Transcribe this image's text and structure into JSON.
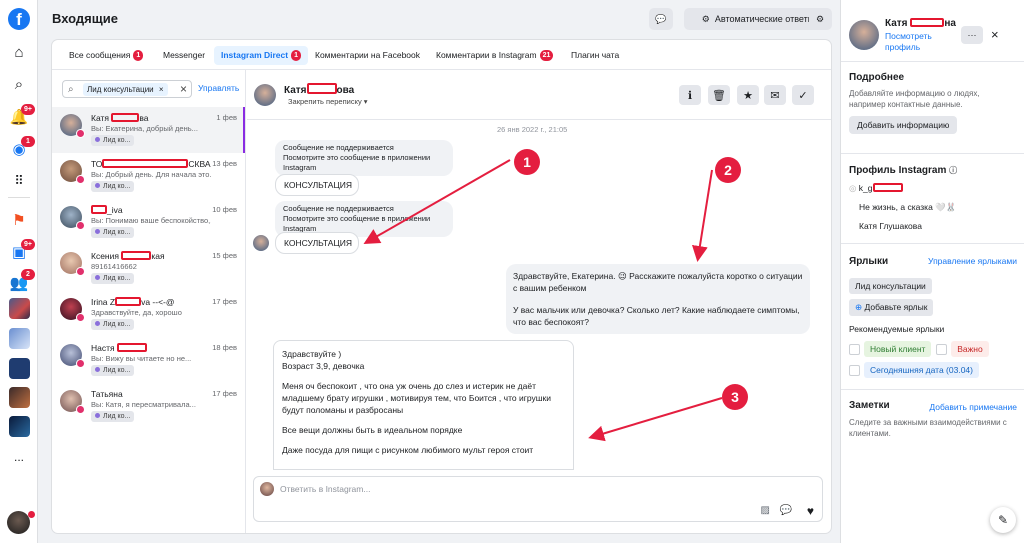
{
  "rail": {
    "badges": {
      "notifications": "9+",
      "messenger": "1",
      "pages": "9+",
      "groups": "2"
    },
    "more": "..."
  },
  "header": {
    "title": "Входящие",
    "auto_replies": "Автоматические ответы"
  },
  "tabs": [
    {
      "label": "Все сообщения",
      "count": "1"
    },
    {
      "label": "Messenger",
      "count": ""
    },
    {
      "label": "Instagram Direct",
      "count": "1"
    },
    {
      "label": "Комментарии на Facebook",
      "count": ""
    },
    {
      "label": "Комментарии в Instagram",
      "count": "21"
    },
    {
      "label": "Плагин чата",
      "count": ""
    }
  ],
  "search": {
    "chip": "Лид консультации",
    "chip_close": "×",
    "clear": "×",
    "manage": "Управлять"
  },
  "conversations": [
    {
      "name_a": "Катя",
      "name_b": "ва",
      "date": "1 фев",
      "preview": "Вы: Екатерина, добрый день...",
      "tag": "Лид ко..."
    },
    {
      "name_a": "ТО",
      "name_b": "СКВА",
      "date": "13 фев",
      "preview": "Вы: Добрый день. Для начала это...",
      "tag": "Лид ко..."
    },
    {
      "name_a": "",
      "name_b": "_iva",
      "date": "10 фев",
      "preview": "Вы: Понимаю ваше беспокойство,...",
      "tag": "Лид ко..."
    },
    {
      "name_a": "Ксения",
      "name_b": "кая",
      "date": "15 фев",
      "preview": "89161416662",
      "tag": "Лид ко..."
    },
    {
      "name_a": "Irina Z",
      "name_b": "va --<-@",
      "date": "17 фев",
      "preview": "Здравствуйте, да, хорошо",
      "tag": "Лид ко..."
    },
    {
      "name_a": "Настя",
      "name_b": "",
      "date": "18 фев",
      "preview": "Вы: Вижу вы читаете но не...",
      "tag": "Лид ко..."
    },
    {
      "name_a": "Татьяна",
      "name_b": "",
      "date": "17 фев",
      "preview": "Вы: Катя, я пересматривала...",
      "tag": "Лид ко..."
    }
  ],
  "chat": {
    "name_a": "Катя",
    "name_b": "ова",
    "pin": "Закрепить переписку",
    "timestamp": "26 янв 2022 г., 21:05",
    "unsupported_title": "Сообщение не поддерживается",
    "unsupported_sub": "Посмотрите это сообщение в приложении Instagram",
    "consult": "КОНСУЛЬТАЦИЯ",
    "out_msg_1": "Здравствуйте, Екатерина. 😉 Расскажите пожалуйста коротко о ситуации с вашим ребенком",
    "out_msg_2": "У вас мальчик или девочка? Сколько лет? Какие наблюдаете симптомы, что вас беспокоят?",
    "in_lines": [
      "Здравствуйте )",
      "Возраст 3,9, девочка",
      "",
      "Меня оч беспокоит , что она уж очень до слез и истерик не даёт младшему брату игрушки , мотивируя тем, что Боится , что игрушки будут поломаны и разбросаны",
      "",
      "Все вещи должны быть в идеальном порядке",
      "",
      "Даже посуда для пищи с рисунком любимого мульт героя стоит"
    ],
    "reply_placeholder": "Ответить в Instagram..."
  },
  "annotations": [
    "1",
    "2",
    "3"
  ],
  "right": {
    "name_a": "Катя",
    "name_b": "на",
    "view_profile": "Посмотреть профиль",
    "more": "···",
    "close": "×",
    "details_title": "Подробнее",
    "details_text": "Добавляйте информацию о людях, например контактные данные.",
    "add_info": "Добавить информацию",
    "ig_title": "Профиль Instagram",
    "ig_handle": "k_g",
    "ig_bio": "Не жизнь, а сказка 🤍🐰",
    "ig_name": "Катя Глушакова",
    "labels_title": "Ярлыки",
    "labels_manage": "Управление ярлыками",
    "label_current": "Лид консультации",
    "add_label": "Добавьте ярлык",
    "recommended": "Рекомендуемые ярлыки",
    "rec": [
      "Новый клиент",
      "Важно",
      "Сегодняшняя дата (03.04)"
    ],
    "notes_title": "Заметки",
    "add_note": "Добавить примечание",
    "notes_text": "Следите за важными взаимодействиями с клиентами."
  },
  "colors": {
    "accent": "#1877f2",
    "badge": "#e41e3f",
    "redact": "#e4172f",
    "selected_bar": "#8a2be2"
  }
}
